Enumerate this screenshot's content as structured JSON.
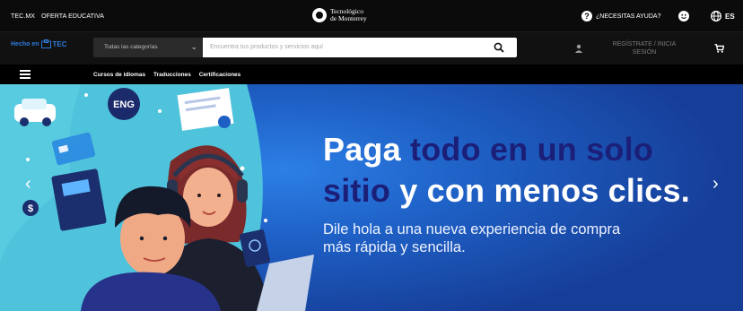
{
  "topbar": {
    "links": [
      "TEC.MX",
      "OFERTA EDUCATIVA"
    ],
    "brand_line1": "Tecnológico",
    "brand_line2": "de Monterrey",
    "help_label": "¿NECESITAS AYUDA?",
    "language": "ES"
  },
  "search": {
    "logo_text": "Hecho en",
    "logo_tec": "TEC",
    "category_label": "Todas las categorías",
    "placeholder": "Encuentra tus productos y servicios aquí",
    "login_label": "REGÍSTRATE / INICIA SESIÓN"
  },
  "nav": {
    "items": [
      "Cursos de idiomas",
      "Traducciones",
      "Certificaciones"
    ]
  },
  "hero": {
    "headline_part1": "Paga ",
    "headline_part2": "todo en un solo",
    "headline_part3": "sitio",
    "headline_part4": " y con menos clics.",
    "subtitle_line1": "Dile hola a una nueva experiencia de compra",
    "subtitle_line2": "más rápida y sencilla.",
    "badge_text": "ENG"
  },
  "icons": {
    "help": "question-circle-icon",
    "smile": "face-icon",
    "globe": "globe-icon",
    "search": "magnifier-icon",
    "user": "user-icon",
    "cart": "cart-icon"
  },
  "colors": {
    "hero_blue": "#1e5fc4",
    "headline_dark": "#1b1f78",
    "bar_black": "#0b0b0b"
  }
}
